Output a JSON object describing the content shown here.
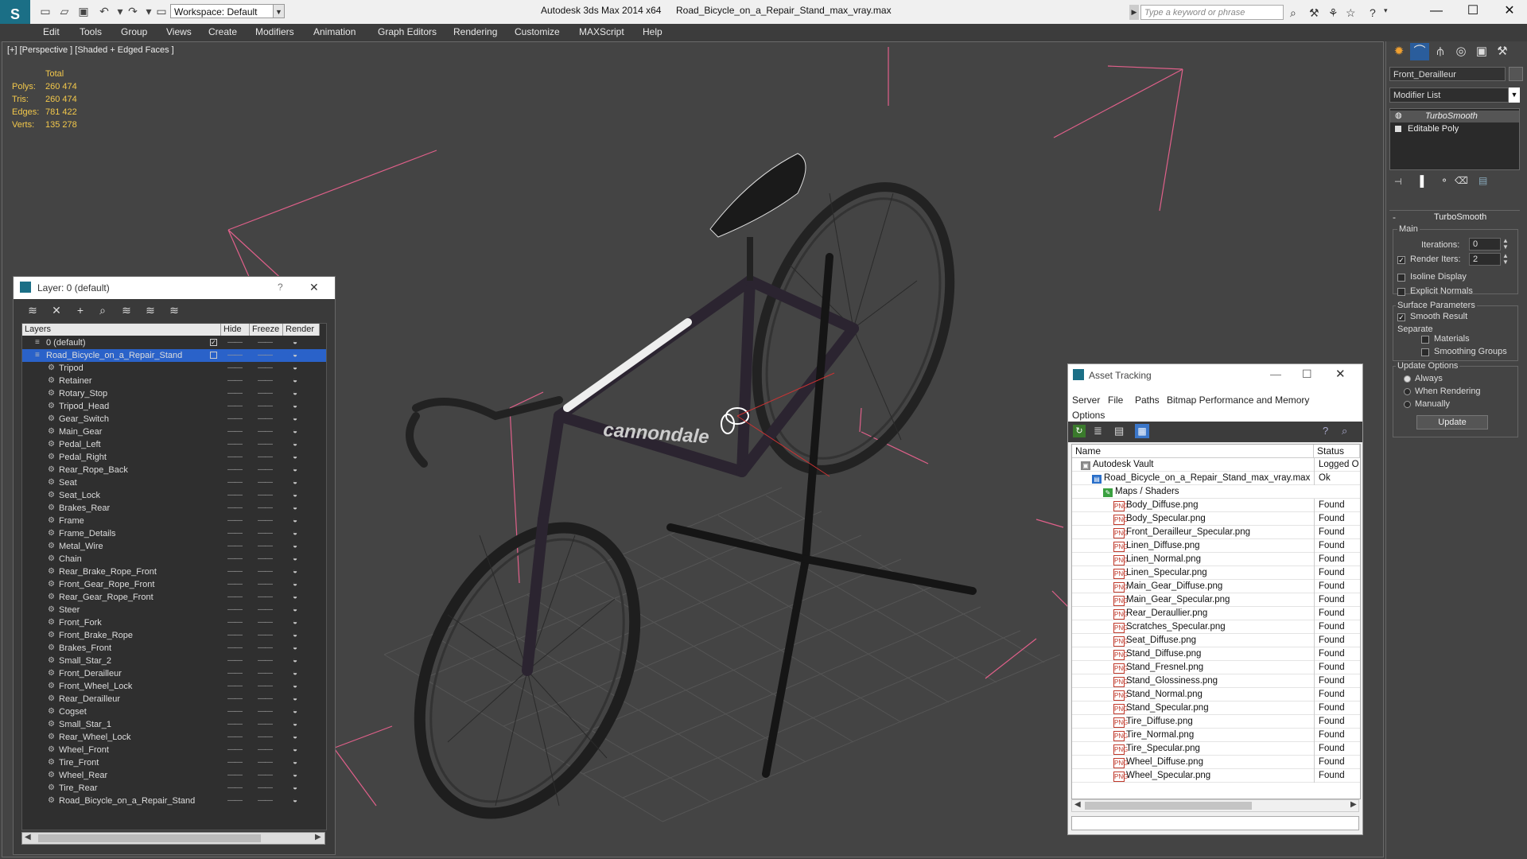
{
  "titlebar": {
    "workspace": "Workspace: Default",
    "app_title": "Autodesk 3ds Max  2014 x64",
    "file_title": "Road_Bicycle_on_a_Repair_Stand_max_vray.max",
    "search_placeholder": "Type a keyword or phrase"
  },
  "menu": [
    "Edit",
    "Tools",
    "Group",
    "Views",
    "Create",
    "Modifiers",
    "Animation",
    "Graph Editors",
    "Rendering",
    "Customize",
    "MAXScript",
    "Help"
  ],
  "viewport": {
    "label": "[+] [Perspective ] [Shaded + Edged Faces ]",
    "stats": {
      "header": "Total",
      "rows": [
        {
          "label": "Polys:",
          "value": "260 474"
        },
        {
          "label": "Tris:",
          "value": "260 474"
        },
        {
          "label": "Edges:",
          "value": "781 422"
        },
        {
          "label": "Verts:",
          "value": "135 278"
        }
      ]
    },
    "frame_text": "cannondale"
  },
  "layer_dialog": {
    "title": "Layer: 0 (default)",
    "help": "?",
    "close": "✕",
    "columns": {
      "layers": "Layers",
      "hide": "Hide",
      "freeze": "Freeze",
      "render": "Render"
    },
    "layers": [
      {
        "name": "0 (default)",
        "level": 0
      },
      {
        "name": "Road_Bicycle_on_a_Repair_Stand",
        "level": 0,
        "selected": true
      },
      {
        "name": "Tripod",
        "level": 1
      },
      {
        "name": "Retainer",
        "level": 1
      },
      {
        "name": "Rotary_Stop",
        "level": 1
      },
      {
        "name": "Tripod_Head",
        "level": 1
      },
      {
        "name": "Gear_Switch",
        "level": 1
      },
      {
        "name": "Main_Gear",
        "level": 1
      },
      {
        "name": "Pedal_Left",
        "level": 1
      },
      {
        "name": "Pedal_Right",
        "level": 1
      },
      {
        "name": "Rear_Rope_Back",
        "level": 1
      },
      {
        "name": "Seat",
        "level": 1
      },
      {
        "name": "Seat_Lock",
        "level": 1
      },
      {
        "name": "Brakes_Rear",
        "level": 1
      },
      {
        "name": "Frame",
        "level": 1
      },
      {
        "name": "Frame_Details",
        "level": 1
      },
      {
        "name": "Metal_Wire",
        "level": 1
      },
      {
        "name": "Chain",
        "level": 1
      },
      {
        "name": "Rear_Brake_Rope_Front",
        "level": 1
      },
      {
        "name": "Front_Gear_Rope_Front",
        "level": 1
      },
      {
        "name": "Rear_Gear_Rope_Front",
        "level": 1
      },
      {
        "name": "Steer",
        "level": 1
      },
      {
        "name": "Front_Fork",
        "level": 1
      },
      {
        "name": "Front_Brake_Rope",
        "level": 1
      },
      {
        "name": "Brakes_Front",
        "level": 1
      },
      {
        "name": "Small_Star_2",
        "level": 1
      },
      {
        "name": "Front_Derailleur",
        "level": 1
      },
      {
        "name": "Front_Wheel_Lock",
        "level": 1
      },
      {
        "name": "Rear_Derailleur",
        "level": 1
      },
      {
        "name": "Cogset",
        "level": 1
      },
      {
        "name": "Small_Star_1",
        "level": 1
      },
      {
        "name": "Rear_Wheel_Lock",
        "level": 1
      },
      {
        "name": "Wheel_Front",
        "level": 1
      },
      {
        "name": "Tire_Front",
        "level": 1
      },
      {
        "name": "Wheel_Rear",
        "level": 1
      },
      {
        "name": "Tire_Rear",
        "level": 1
      },
      {
        "name": "Road_Bicycle_on_a_Repair_Stand",
        "level": 1
      }
    ]
  },
  "asset_tracking": {
    "title": "Asset Tracking",
    "menu": [
      "Server",
      "File",
      "Paths",
      "Bitmap Performance and Memory",
      "Options"
    ],
    "columns": {
      "name": "Name",
      "status": "Status"
    },
    "rows": [
      {
        "name": "Autodesk Vault",
        "status": "Logged O",
        "level": 0,
        "icon": "vault"
      },
      {
        "name": "Road_Bicycle_on_a_Repair_Stand_max_vray.max",
        "status": "Ok",
        "level": 1,
        "icon": "max"
      },
      {
        "name": "Maps / Shaders",
        "status": "",
        "level": 2,
        "icon": "folder"
      },
      {
        "name": "Body_Diffuse.png",
        "status": "Found",
        "level": 3,
        "icon": "png"
      },
      {
        "name": "Body_Specular.png",
        "status": "Found",
        "level": 3,
        "icon": "png"
      },
      {
        "name": "Front_Derailleur_Specular.png",
        "status": "Found",
        "level": 3,
        "icon": "png"
      },
      {
        "name": "Linen_Diffuse.png",
        "status": "Found",
        "level": 3,
        "icon": "png"
      },
      {
        "name": "Linen_Normal.png",
        "status": "Found",
        "level": 3,
        "icon": "png"
      },
      {
        "name": "Linen_Specular.png",
        "status": "Found",
        "level": 3,
        "icon": "png"
      },
      {
        "name": "Main_Gear_Diffuse.png",
        "status": "Found",
        "level": 3,
        "icon": "png"
      },
      {
        "name": "Main_Gear_Specular.png",
        "status": "Found",
        "level": 3,
        "icon": "png"
      },
      {
        "name": "Rear_Deraullier.png",
        "status": "Found",
        "level": 3,
        "icon": "png"
      },
      {
        "name": "Scratches_Specular.png",
        "status": "Found",
        "level": 3,
        "icon": "png"
      },
      {
        "name": "Seat_Diffuse.png",
        "status": "Found",
        "level": 3,
        "icon": "png"
      },
      {
        "name": "Stand_Diffuse.png",
        "status": "Found",
        "level": 3,
        "icon": "png"
      },
      {
        "name": "Stand_Fresnel.png",
        "status": "Found",
        "level": 3,
        "icon": "png"
      },
      {
        "name": "Stand_Glossiness.png",
        "status": "Found",
        "level": 3,
        "icon": "png"
      },
      {
        "name": "Stand_Normal.png",
        "status": "Found",
        "level": 3,
        "icon": "png"
      },
      {
        "name": "Stand_Specular.png",
        "status": "Found",
        "level": 3,
        "icon": "png"
      },
      {
        "name": "Tire_Diffuse.png",
        "status": "Found",
        "level": 3,
        "icon": "png"
      },
      {
        "name": "Tire_Normal.png",
        "status": "Found",
        "level": 3,
        "icon": "png"
      },
      {
        "name": "Tire_Specular.png",
        "status": "Found",
        "level": 3,
        "icon": "png"
      },
      {
        "name": "Wheel_Diffuse.png",
        "status": "Found",
        "level": 3,
        "icon": "png"
      },
      {
        "name": "Wheel_Specular.png",
        "status": "Found",
        "level": 3,
        "icon": "png"
      }
    ]
  },
  "command_panel": {
    "object_name": "Front_Derailleur",
    "modifier_list": "Modifier List",
    "stack": [
      "TurboSmooth",
      "Editable Poly"
    ],
    "rollout_title": "TurboSmooth",
    "main_group": "Main",
    "iterations_label": "Iterations:",
    "iterations_value": "0",
    "render_iters_label": "Render Iters:",
    "render_iters_value": "2",
    "isoline": "Isoline Display",
    "explicit_normals": "Explicit Normals",
    "surface_group": "Surface Parameters",
    "smooth_result": "Smooth Result",
    "separate": "Separate",
    "materials": "Materials",
    "smoothing_groups": "Smoothing Groups",
    "update_group": "Update Options",
    "always": "Always",
    "when_rendering": "When Rendering",
    "manually": "Manually",
    "update_button": "Update"
  },
  "colors": {
    "accent": "#1b6f86",
    "selection": "#2a62c9",
    "stats": "#f3c84b",
    "viewport_bg": "#444444",
    "light_lines": "#e0608a"
  }
}
